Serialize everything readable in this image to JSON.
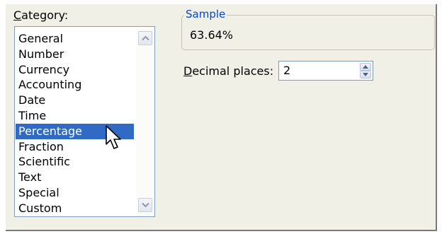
{
  "category": {
    "label_first": "C",
    "label_rest": "ategory:",
    "items": [
      {
        "label": "General"
      },
      {
        "label": "Number"
      },
      {
        "label": "Currency"
      },
      {
        "label": "Accounting"
      },
      {
        "label": "Date"
      },
      {
        "label": "Time"
      },
      {
        "label": "Percentage",
        "selected": true
      },
      {
        "label": "Fraction"
      },
      {
        "label": "Scientific"
      },
      {
        "label": "Text"
      },
      {
        "label": "Special"
      },
      {
        "label": "Custom"
      }
    ]
  },
  "sample": {
    "legend": "Sample",
    "value": "63.64%"
  },
  "decimal_places": {
    "label_first": "D",
    "label_rest": "ecimal places:",
    "value": "2"
  },
  "colors": {
    "selection": "#316ac5",
    "legend_text": "#0046d5",
    "panel_bg": "#f1f0e7"
  },
  "icons": {
    "scroll_up": "chevron-up-icon",
    "scroll_down": "chevron-down-icon",
    "spin_up": "spin-up-icon",
    "spin_down": "spin-down-icon",
    "cursor": "mouse-pointer-icon"
  }
}
